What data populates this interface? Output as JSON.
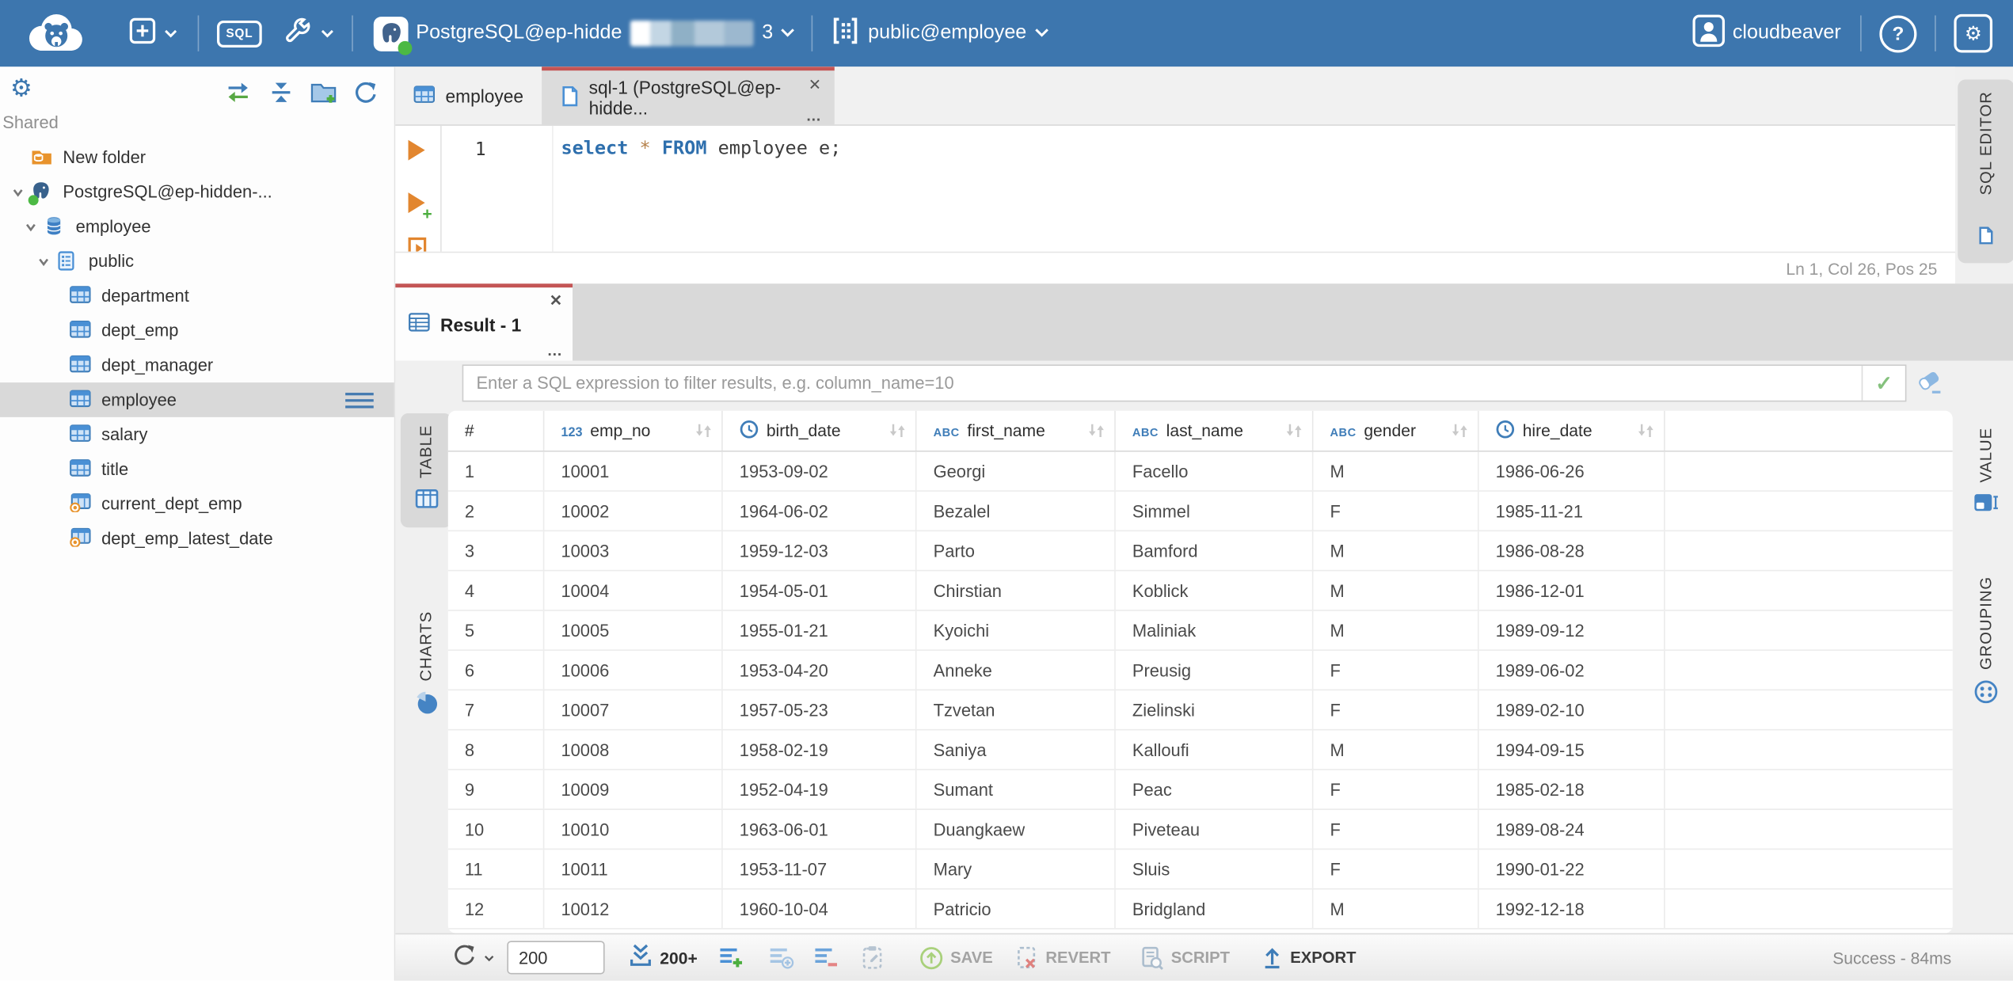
{
  "header": {
    "sql_button_label": "SQL",
    "connection_label": "PostgreSQL@ep-hidde",
    "connection_suffix": "3",
    "schema_selector": "public@employee",
    "user_name": "cloudbeaver"
  },
  "icons": {
    "close": "✕",
    "more": "…",
    "gear": "⚙",
    "question": "?",
    "check": "✓"
  },
  "colors": {
    "header_blue": "#3d76ae",
    "accent_red": "#c45555",
    "icon_blue": "#3f7db8",
    "success_green": "#4cae3f"
  },
  "sidebar": {
    "section_label": "Shared",
    "tree": [
      {
        "label": "New folder",
        "icon": "folder-database",
        "depth": 0,
        "chevron": false,
        "selected": false
      },
      {
        "label": "PostgreSQL@ep-hidden-...",
        "icon": "postgres",
        "depth": 0,
        "chevron": true,
        "selected": false
      },
      {
        "label": "employee",
        "icon": "database",
        "depth": 1,
        "chevron": true,
        "selected": false
      },
      {
        "label": "public",
        "icon": "schema",
        "depth": 2,
        "chevron": true,
        "selected": false
      },
      {
        "label": "department",
        "icon": "table",
        "depth": 3,
        "chevron": false,
        "selected": false
      },
      {
        "label": "dept_emp",
        "icon": "table",
        "depth": 3,
        "chevron": false,
        "selected": false
      },
      {
        "label": "dept_manager",
        "icon": "table",
        "depth": 3,
        "chevron": false,
        "selected": false
      },
      {
        "label": "employee",
        "icon": "table",
        "depth": 3,
        "chevron": false,
        "selected": true
      },
      {
        "label": "salary",
        "icon": "table",
        "depth": 3,
        "chevron": false,
        "selected": false
      },
      {
        "label": "title",
        "icon": "table",
        "depth": 3,
        "chevron": false,
        "selected": false
      },
      {
        "label": "current_dept_emp",
        "icon": "view",
        "depth": 3,
        "chevron": false,
        "selected": false
      },
      {
        "label": "dept_emp_latest_date",
        "icon": "view",
        "depth": 3,
        "chevron": false,
        "selected": false
      }
    ]
  },
  "editor": {
    "tabs": [
      {
        "label": "employee",
        "active": false
      },
      {
        "label": "sql-1 (PostgreSQL@ep-hidde...",
        "active": true
      }
    ],
    "line_number": "1",
    "code": {
      "kw1": "select",
      "star": "*",
      "kw2": "FROM",
      "rest": "employee e;"
    },
    "status": "Ln 1, Col 26, Pos 25",
    "side_tab": "SQL EDITOR"
  },
  "result": {
    "tab_label": "Result - 1",
    "filter_placeholder": "Enter a SQL expression to filter results, e.g. column_name=10",
    "left_tabs": [
      "TABLE",
      "CHARTS"
    ],
    "right_tabs": [
      "VALUE",
      "GROUPING"
    ]
  },
  "grid": {
    "columns": [
      {
        "label": "#",
        "type": "rownum"
      },
      {
        "label": "emp_no",
        "type": "number"
      },
      {
        "label": "birth_date",
        "type": "date"
      },
      {
        "label": "first_name",
        "type": "string"
      },
      {
        "label": "last_name",
        "type": "string"
      },
      {
        "label": "gender",
        "type": "string"
      },
      {
        "label": "hire_date",
        "type": "date"
      }
    ],
    "rows": [
      [
        "1",
        "10001",
        "1953-09-02",
        "Georgi",
        "Facello",
        "M",
        "1986-06-26"
      ],
      [
        "2",
        "10002",
        "1964-06-02",
        "Bezalel",
        "Simmel",
        "F",
        "1985-11-21"
      ],
      [
        "3",
        "10003",
        "1959-12-03",
        "Parto",
        "Bamford",
        "M",
        "1986-08-28"
      ],
      [
        "4",
        "10004",
        "1954-05-01",
        "Chirstian",
        "Koblick",
        "M",
        "1986-12-01"
      ],
      [
        "5",
        "10005",
        "1955-01-21",
        "Kyoichi",
        "Maliniak",
        "M",
        "1989-09-12"
      ],
      [
        "6",
        "10006",
        "1953-04-20",
        "Anneke",
        "Preusig",
        "F",
        "1989-06-02"
      ],
      [
        "7",
        "10007",
        "1957-05-23",
        "Tzvetan",
        "Zielinski",
        "F",
        "1989-02-10"
      ],
      [
        "8",
        "10008",
        "1958-02-19",
        "Saniya",
        "Kalloufi",
        "M",
        "1994-09-15"
      ],
      [
        "9",
        "10009",
        "1952-04-19",
        "Sumant",
        "Peac",
        "F",
        "1985-02-18"
      ],
      [
        "10",
        "10010",
        "1963-06-01",
        "Duangkaew",
        "Piveteau",
        "F",
        "1989-08-24"
      ],
      [
        "11",
        "10011",
        "1953-11-07",
        "Mary",
        "Sluis",
        "F",
        "1990-01-22"
      ],
      [
        "12",
        "10012",
        "1960-10-04",
        "Patricio",
        "Bridgland",
        "M",
        "1992-12-18"
      ]
    ]
  },
  "toolbar": {
    "row_limit": "200",
    "fetch_more": "200+",
    "save_label": "SAVE",
    "revert_label": "REVERT",
    "script_label": "SCRIPT",
    "export_label": "EXPORT",
    "status": "Success - 84ms"
  }
}
